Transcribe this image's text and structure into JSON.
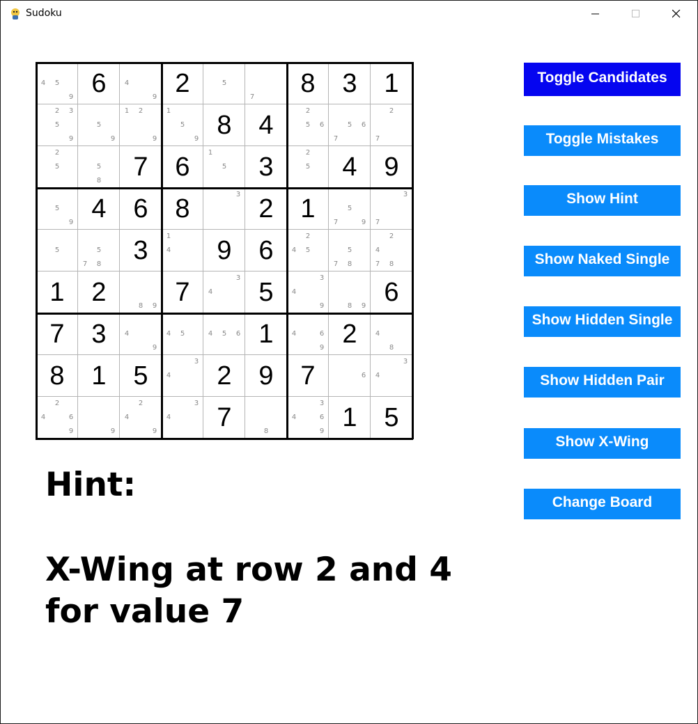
{
  "window": {
    "title": "Sudoku",
    "icon": "python-snake-icon",
    "controls": [
      "minimize",
      "maximize",
      "close"
    ]
  },
  "board": {
    "values": [
      [
        0,
        6,
        0,
        2,
        0,
        0,
        8,
        3,
        1
      ],
      [
        0,
        0,
        0,
        0,
        8,
        4,
        0,
        0,
        0
      ],
      [
        0,
        0,
        7,
        6,
        0,
        3,
        0,
        4,
        9
      ],
      [
        0,
        4,
        6,
        8,
        0,
        2,
        1,
        0,
        0
      ],
      [
        0,
        0,
        3,
        0,
        9,
        6,
        0,
        0,
        0
      ],
      [
        1,
        2,
        0,
        7,
        0,
        5,
        0,
        0,
        6
      ],
      [
        7,
        3,
        0,
        0,
        0,
        1,
        0,
        2,
        0
      ],
      [
        8,
        1,
        5,
        0,
        2,
        9,
        7,
        0,
        0
      ],
      [
        0,
        0,
        0,
        0,
        7,
        0,
        0,
        1,
        5
      ]
    ],
    "candidates": [
      [
        [
          4,
          5,
          9
        ],
        [],
        [
          4,
          9
        ],
        [],
        [
          5
        ],
        [
          7
        ],
        [],
        [],
        []
      ],
      [
        [
          2,
          3,
          5,
          9
        ],
        [
          5,
          9
        ],
        [
          1,
          2,
          9
        ],
        [
          1,
          5,
          9
        ],
        [],
        [],
        [
          2,
          5,
          6
        ],
        [
          5,
          6,
          7
        ],
        [
          2,
          7
        ]
      ],
      [
        [
          2,
          5
        ],
        [
          5,
          8
        ],
        [],
        [],
        [
          1,
          5
        ],
        [],
        [
          2,
          5
        ],
        [],
        []
      ],
      [
        [
          5,
          9
        ],
        [],
        [],
        [],
        [
          3
        ],
        [],
        [],
        [
          5,
          7,
          9
        ],
        [
          3,
          7
        ]
      ],
      [
        [
          5
        ],
        [
          5,
          7,
          8
        ],
        [],
        [
          1,
          4
        ],
        [],
        [],
        [
          2,
          4,
          5
        ],
        [
          5,
          7,
          8
        ],
        [
          2,
          4,
          7,
          8
        ]
      ],
      [
        [],
        [],
        [
          8,
          9
        ],
        [],
        [
          3,
          4
        ],
        [],
        [
          3,
          4,
          9
        ],
        [
          8,
          9
        ],
        []
      ],
      [
        [],
        [],
        [
          4,
          9
        ],
        [
          4,
          5
        ],
        [
          4,
          5,
          6
        ],
        [],
        [
          4,
          6,
          9
        ],
        [],
        [
          4,
          8
        ]
      ],
      [
        [],
        [],
        [],
        [
          3,
          4
        ],
        [],
        [],
        [],
        [
          6
        ],
        [
          3,
          4
        ]
      ],
      [
        [
          2,
          4,
          6,
          9
        ],
        [
          9
        ],
        [
          2,
          4,
          9
        ],
        [
          3,
          4
        ],
        [],
        [
          8
        ],
        [
          3,
          4,
          6,
          9
        ],
        [],
        []
      ]
    ]
  },
  "buttons": [
    {
      "label": "Toggle Candidates",
      "active": true
    },
    {
      "label": "Toggle Mistakes",
      "active": false
    },
    {
      "label": "Show Hint",
      "active": false
    },
    {
      "label": "Show Naked Single",
      "active": false
    },
    {
      "label": "Show Hidden Single",
      "active": false
    },
    {
      "label": "Show Hidden Pair",
      "active": false
    },
    {
      "label": "Show X-Wing",
      "active": false
    },
    {
      "label": "Change Board",
      "active": false
    }
  ],
  "hint": {
    "heading": "Hint:",
    "line1": "X-Wing at row 2 and 4",
    "line2": "for value 7"
  },
  "colors": {
    "button": "#0a8bfb",
    "button_active": "#0505f0",
    "button_text": "#ffffff",
    "candidate_text": "#888888",
    "grid_thin": "#b4b4b4",
    "grid_thick": "#000000"
  }
}
